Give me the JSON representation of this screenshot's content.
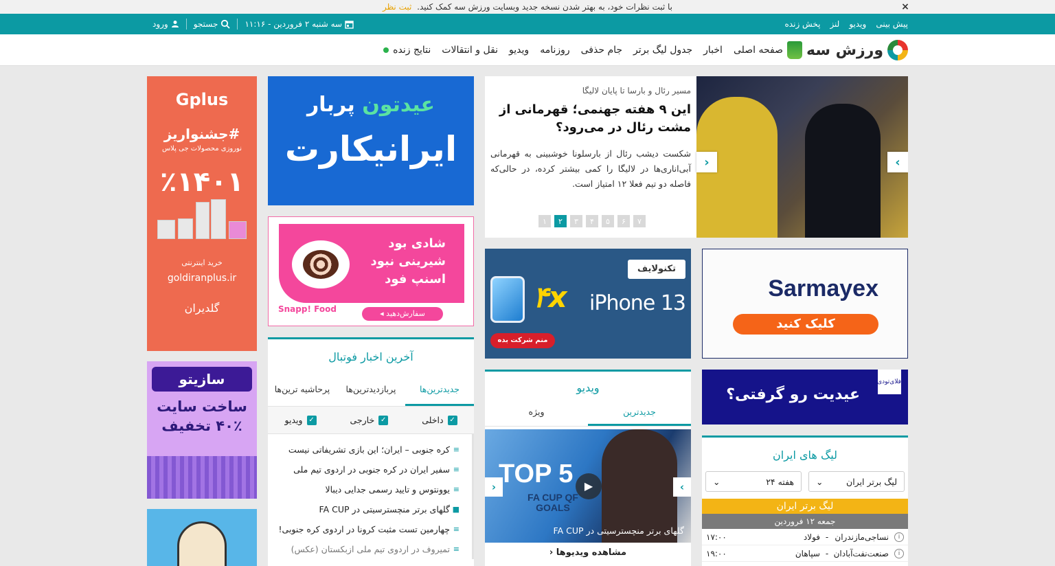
{
  "notice": {
    "text": "با ثبت نظرات خود، به بهتر شدن نسخه جدید وبسایت ورزش سه کمک کنید.",
    "link": "ثبت نظر",
    "close": "×"
  },
  "topbar": {
    "links": [
      "پیش بینی",
      "ویدیو",
      "لنز",
      "پخش زنده"
    ],
    "date": "سه شنبه ۲ فروردین - ۱۱:۱۶",
    "search": "جستجو",
    "login": "ورود"
  },
  "logo": {
    "name": "ورزش سه"
  },
  "menu": [
    "صفحه اصلی",
    "اخبار",
    "جدول لیگ برتر",
    "جام حذفی",
    "روزنامه",
    "ویدیو",
    "نقل و انتقالات",
    "نتایج زنده"
  ],
  "slider": {
    "kicker": "مسیر رئال و بارسا تا پایان لالیگا",
    "title": "این ۹ هفته جهنمی؛ قهرمانی از مشت رئال در می‌رود؟",
    "lead": "شکست دیشب رئال از بارسلونا خوشبینی به قهرمانی آبی‌اناری‌ها در لالیگا را کمی بیشتر کرده، در حالی‌که فاصله دو تیم فعلا ۱۲ امتیاز است.",
    "pages": [
      "۱",
      "۲",
      "۳",
      "۴",
      "۵",
      "۶",
      "۷"
    ],
    "active_page": "۲"
  },
  "ads": {
    "gplus": {
      "brand": "Gplus",
      "tag": "#جشنواریز",
      "sub": "نوروزی محصولات جی پلاس",
      "big": "٪۱۴۰۱",
      "buy": "خرید اینترنتی",
      "site": "goldiranplus.ir",
      "gold": "گلدیران"
    },
    "sazito": {
      "brand": "سازیتو",
      "l1": "ساخت سایت",
      "l2": "۴۰٪ تخفیف"
    },
    "iranikart": {
      "t1a": "عیدتون",
      "t1b": "پربار",
      "t2": "ایرانیکارت"
    },
    "snapp": {
      "lines": [
        "شادی بود",
        "شیرینی نبود",
        "اسنپ فود"
      ],
      "logo": "Snapp! Food",
      "cta": "سفارش‌دهید ◂"
    },
    "iphone": {
      "logo": "تکنولایف",
      "model": "iPhone 13",
      "x4": "۴x",
      "cta": "منم شرکت بده"
    },
    "sarmayex": {
      "brand": "Sarmayex",
      "cta": "کلیک کنید"
    },
    "eidi": {
      "text": "عیدیت رو گرفتی؟",
      "badge": "فلای‌تودی"
    }
  },
  "news": {
    "title": "آخرین اخبار فوتبال",
    "tabs": [
      "جدیدترین‌ها",
      "پربازدیدترین‌ها",
      "پرحاشیه ترین‌ها"
    ],
    "filters": [
      "داخلی",
      "خارجی",
      "ویدیو"
    ],
    "items": [
      "کره جنوبی – ایران؛ این بازی تشریفاتی نیست",
      "سفیر ایران در کره جنوبی در اردوی تیم ملی",
      "یوونتوس و تایید رسمی جدایی دیبالا",
      "گلهای برتر منچسترسیتی در FA CUP",
      "چهارمین تست مثبت کرونا در اردوی کره جنوبی!",
      "تمیروف در اردوی تیم ملی ازبکستان (عکس)"
    ]
  },
  "video": {
    "title": "ویدیو",
    "tabs": [
      "جدیدترین",
      "ویژه"
    ],
    "thumb_title": "TOP 5",
    "thumb_sub": "FA CUP QF GOALS",
    "caption": "گلهای برتر منچسترسیتی در FA CUP",
    "more": "مشاهده ویدیوها"
  },
  "leagues": {
    "title": "لیگ های ایران",
    "league_select": "لیگ برتر ایران",
    "week_select": "هفته ۲۴",
    "league_name": "لیگ برتر ایران",
    "date": "جمعه ۱۲ فروردین",
    "matches": [
      {
        "home": "نساجی‌مازندران",
        "away": "فولاد",
        "time": "۱۷:۰۰"
      },
      {
        "home": "صنعت‌نفت‌آبادان",
        "away": "سپاهان",
        "time": "۱۹:۰۰"
      }
    ]
  },
  "colors": {
    "teal": "#0c9aa3",
    "orange": "#f3b415"
  }
}
